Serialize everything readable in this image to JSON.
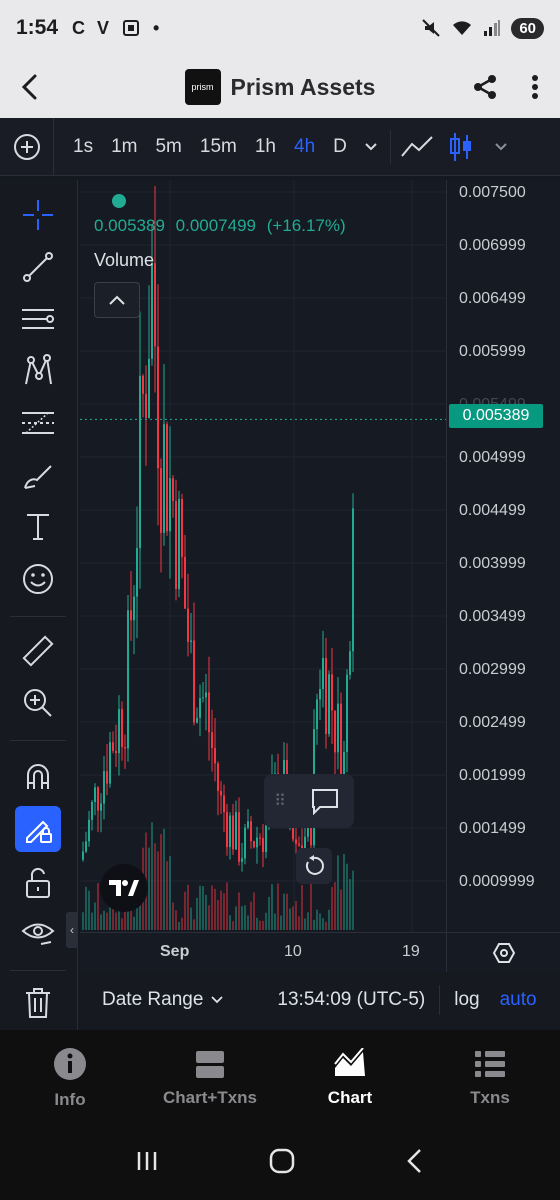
{
  "status_bar": {
    "time": "1:54",
    "left_icons": [
      "C",
      "V"
    ],
    "battery": "60"
  },
  "header": {
    "title": "Prism Assets",
    "logo_text": "prism"
  },
  "toolbar": {
    "intervals": [
      "1s",
      "1m",
      "5m",
      "15m",
      "1h",
      "4h",
      "D"
    ],
    "active_interval": "4h"
  },
  "chart": {
    "legend_price": "0.005389",
    "legend_change": "0.0007499",
    "legend_change_pct": "(+16.17%)",
    "volume_label": "Volume",
    "price_ticks": [
      "0.007500",
      "0.006999",
      "0.006499",
      "0.005999",
      "0.005499",
      "0.004999",
      "0.004499",
      "0.003999",
      "0.003499",
      "0.002999",
      "0.002499",
      "0.001999",
      "0.001499",
      "0.0009999"
    ],
    "current_price_label": "0.005389",
    "time_ticks": [
      "Sep",
      "10",
      "19"
    ],
    "up_color": "#22ab94",
    "down_color": "#f23645"
  },
  "chart_data": {
    "type": "candlestick",
    "y_axis_range": [
      0.0009999,
      0.0075
    ],
    "last_price": 0.005389,
    "x_axis_labels": [
      "Sep",
      "10",
      "19"
    ]
  },
  "infobar": {
    "date_range": "Date Range",
    "clock": "13:54:09 (UTC-5)",
    "log": "log",
    "auto": "auto"
  },
  "bottom_nav": {
    "items": [
      {
        "label": "Info",
        "icon": "info-icon"
      },
      {
        "label": "Chart+Txns",
        "icon": "split-view-icon"
      },
      {
        "label": "Chart",
        "icon": "area-chart-icon"
      },
      {
        "label": "Txns",
        "icon": "list-icon"
      }
    ],
    "active": "Chart"
  }
}
